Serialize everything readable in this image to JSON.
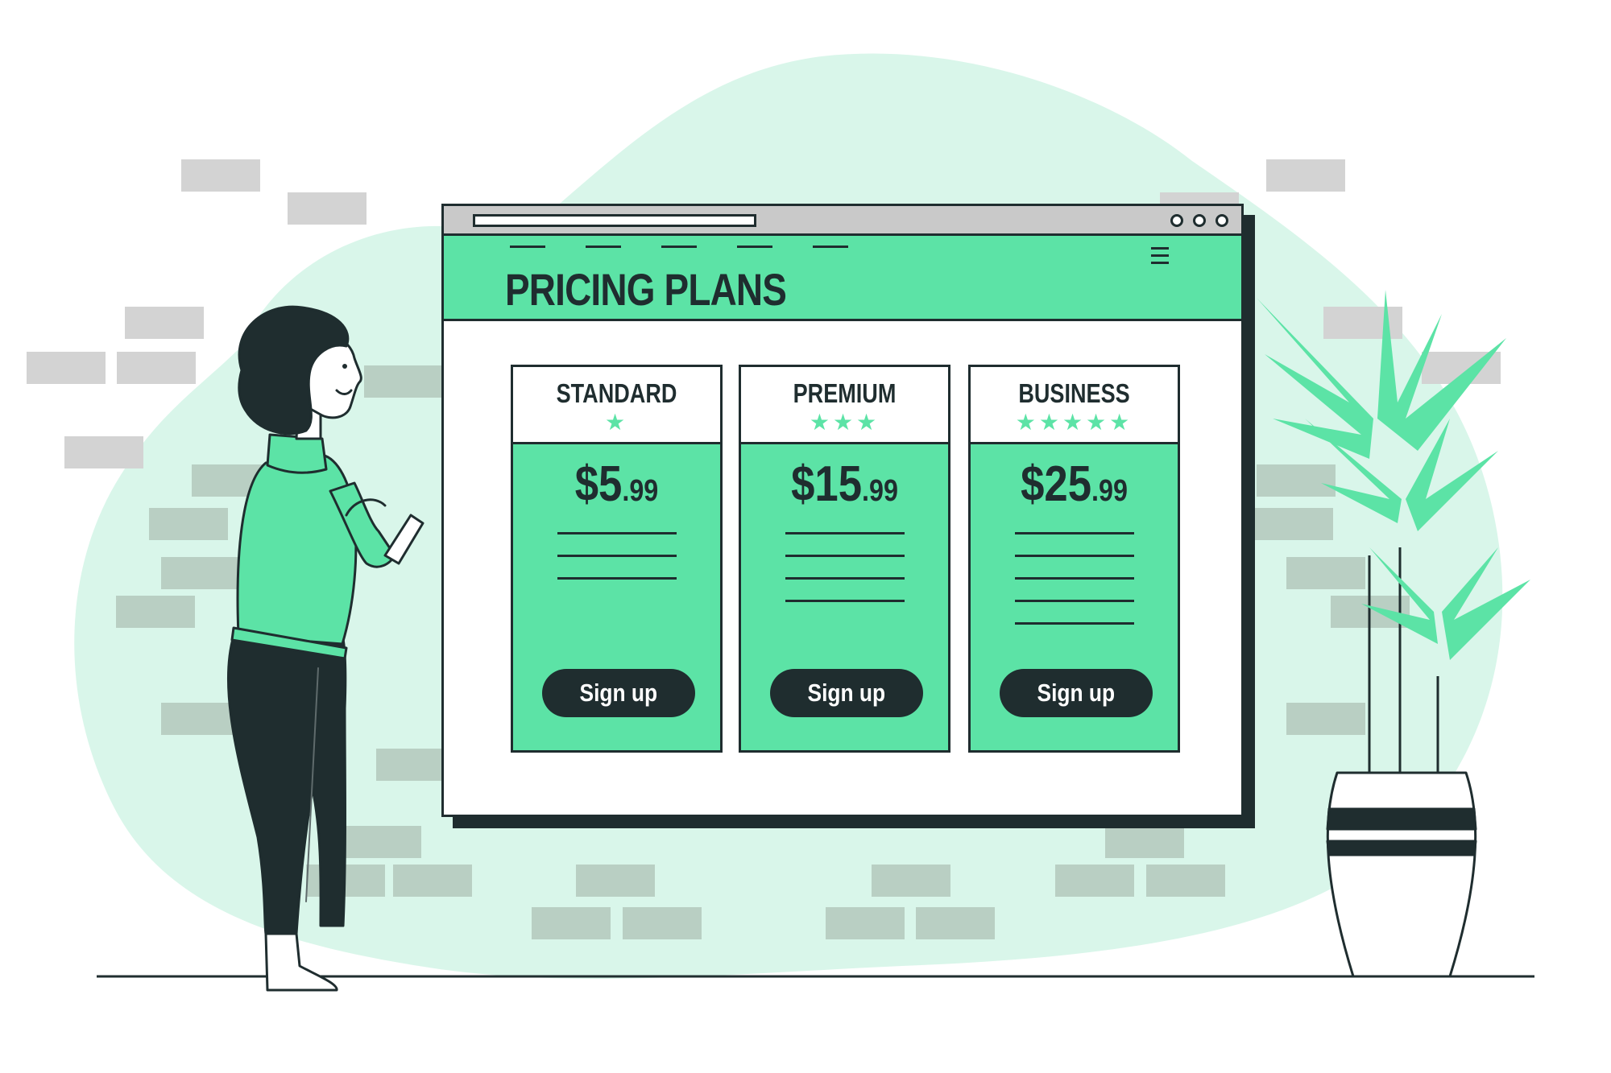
{
  "page": {
    "title": "PRICING PLANS"
  },
  "plans": [
    {
      "name": "STANDARD",
      "stars": "★",
      "rating": 1,
      "price_main": "$5",
      "price_cents": ".99",
      "feature_line_count": 3,
      "button_label": "Sign up"
    },
    {
      "name": "PREMIUM",
      "stars": "★★★",
      "rating": 3,
      "price_main": "$15",
      "price_cents": ".99",
      "feature_line_count": 4,
      "button_label": "Sign up"
    },
    {
      "name": "BUSINESS",
      "stars": "★★★★★",
      "rating": 5,
      "price_main": "$25",
      "price_cents": ".99",
      "feature_line_count": 5,
      "button_label": "Sign up"
    }
  ],
  "colors": {
    "accent": "#5ce3a6",
    "dark": "#1f2d2f",
    "blob": "#d9f6ea",
    "brick_light": "#d3d3d3",
    "brick_dim": "#b9cfc3"
  },
  "icons": [
    "hamburger-menu-icon",
    "window-dot-icon",
    "star-icon",
    "plant-icon",
    "woman-figure"
  ]
}
